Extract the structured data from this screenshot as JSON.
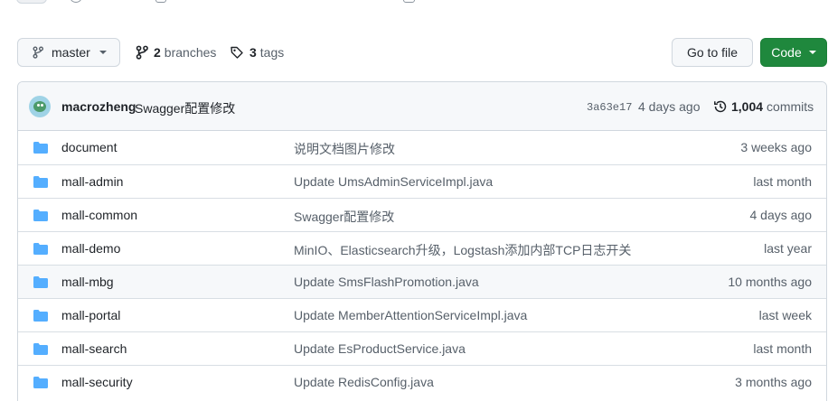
{
  "toolbar": {
    "branch_label": "master",
    "branches_count": "2",
    "branches_label": "branches",
    "tags_count": "3",
    "tags_label": "tags",
    "goto_file_label": "Go to file",
    "code_label": "Code"
  },
  "latest_commit": {
    "author": "macrozheng",
    "message": "Swagger配置修改",
    "sha": "3a63e17",
    "time": "4 days ago",
    "commits_count": "1,004",
    "commits_label": "commits"
  },
  "files": [
    {
      "name": "document",
      "message": "说明文档图片修改",
      "age": "3 weeks ago"
    },
    {
      "name": "mall-admin",
      "message": "Update UmsAdminServiceImpl.java",
      "age": "last month"
    },
    {
      "name": "mall-common",
      "message": "Swagger配置修改",
      "age": "4 days ago"
    },
    {
      "name": "mall-demo",
      "message": "MinIO、Elasticsearch升级，Logstash添加内部TCP日志开关",
      "age": "last year"
    },
    {
      "name": "mall-mbg",
      "message": "Update SmsFlashPromotion.java",
      "age": "10 months ago"
    },
    {
      "name": "mall-portal",
      "message": "Update MemberAttentionServiceImpl.java",
      "age": "last week"
    },
    {
      "name": "mall-search",
      "message": "Update EsProductService.java",
      "age": "last month"
    },
    {
      "name": "mall-security",
      "message": "Update RedisConfig.java",
      "age": "3 months ago"
    }
  ],
  "colors": {
    "folder": "#54aeff",
    "code_button": "#1f883d",
    "muted_text": "#57606a"
  },
  "icons": [
    "git-branch-icon",
    "branches-icon",
    "tag-icon",
    "history-icon",
    "folder-icon",
    "avatar"
  ]
}
